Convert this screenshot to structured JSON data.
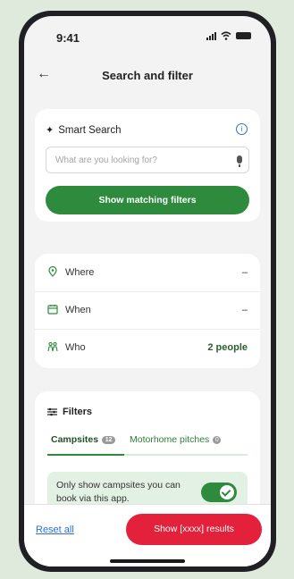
{
  "status": {
    "time": "9:41"
  },
  "header": {
    "title": "Search and filter",
    "back_icon": "arrow-left-icon"
  },
  "smart_search": {
    "title": "Smart Search",
    "placeholder": "What are you looking for?",
    "button_label": "Show matching filters"
  },
  "where_when_who": {
    "where_label": "Where",
    "where_value": "–",
    "when_label": "When",
    "when_value": "–",
    "who_label": "Who",
    "who_value": "2 people"
  },
  "filters": {
    "title": "Filters",
    "tabs": [
      {
        "label": "Campsites",
        "badge": "12"
      },
      {
        "label": "Motorhome pitches",
        "badge": "0"
      }
    ],
    "toggle_text": "Only show campsites you can book via this app.",
    "toggle_on": true
  },
  "footer": {
    "reset_label": "Reset all",
    "show_button_label": "Show [xxxx] results"
  },
  "colors": {
    "accent_green": "#2e8b3e",
    "cta_red": "#e3213a",
    "link_blue": "#2d6fd6"
  }
}
